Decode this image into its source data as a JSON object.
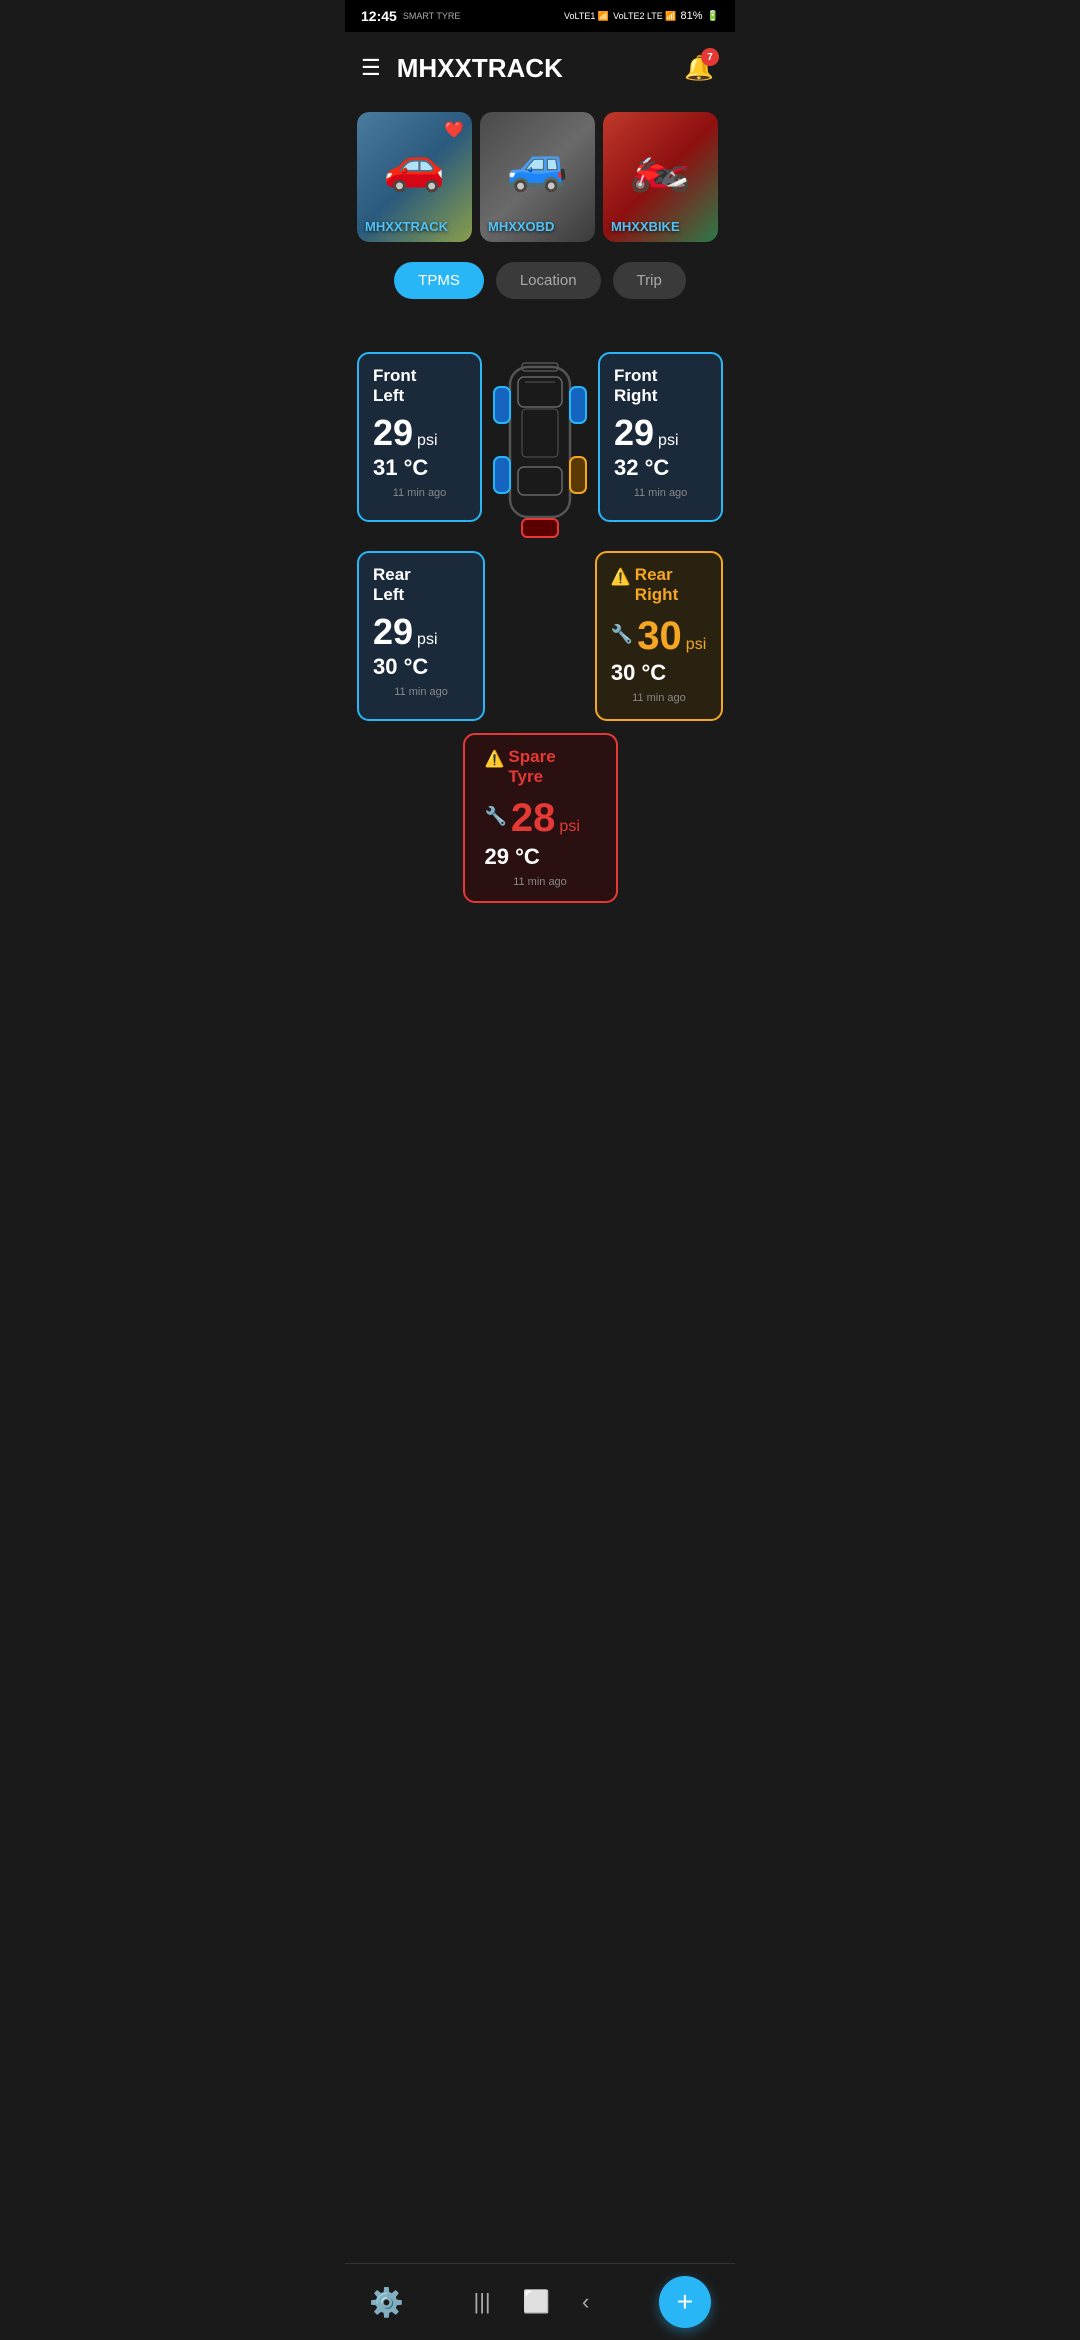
{
  "statusBar": {
    "time": "12:45",
    "brand": "SMART TYRE",
    "signal1": "VoLTE1",
    "signal2": "VoLTE2 LTE",
    "battery": "81%"
  },
  "header": {
    "title": "MHXXTRACK",
    "notifCount": "7"
  },
  "vehicles": [
    {
      "id": "v1",
      "name": "MHXXTRACK",
      "hasFav": true,
      "emoji": "🚗",
      "bgClass": "car1-bg"
    },
    {
      "id": "v2",
      "name": "MHXXOBD",
      "hasFav": false,
      "emoji": "🚙",
      "bgClass": "car2-bg"
    },
    {
      "id": "v3",
      "name": "MHXXBIKE",
      "hasFav": false,
      "emoji": "🏍️",
      "bgClass": "bike-bg"
    }
  ],
  "tabs": [
    {
      "id": "tpms",
      "label": "TPMS",
      "active": true
    },
    {
      "id": "location",
      "label": "Location",
      "active": false
    },
    {
      "id": "trip",
      "label": "Trip",
      "active": false
    }
  ],
  "tpms": {
    "frontLeft": {
      "name": "Front\nLeft",
      "psi": "29",
      "unit": "psi",
      "temp": "31 °C",
      "time": "11 min ago",
      "status": "normal"
    },
    "frontRight": {
      "name": "Front\nRight",
      "psi": "29",
      "unit": "psi",
      "temp": "32 °C",
      "time": "11 min ago",
      "status": "normal"
    },
    "rearLeft": {
      "name": "Rear\nLeft",
      "psi": "29",
      "unit": "psi",
      "temp": "30 °C",
      "time": "11 min ago",
      "status": "normal"
    },
    "rearRight": {
      "name": "Rear\nRight",
      "psi": "30",
      "unit": "psi",
      "temp": "30 °C",
      "time": "11 min ago",
      "status": "warning"
    },
    "spare": {
      "name": "Spare\nTyre",
      "psi": "28",
      "unit": "psi",
      "temp": "29 °C",
      "time": "11 min ago",
      "status": "danger"
    }
  },
  "bottomBar": {
    "addLabel": "+"
  }
}
